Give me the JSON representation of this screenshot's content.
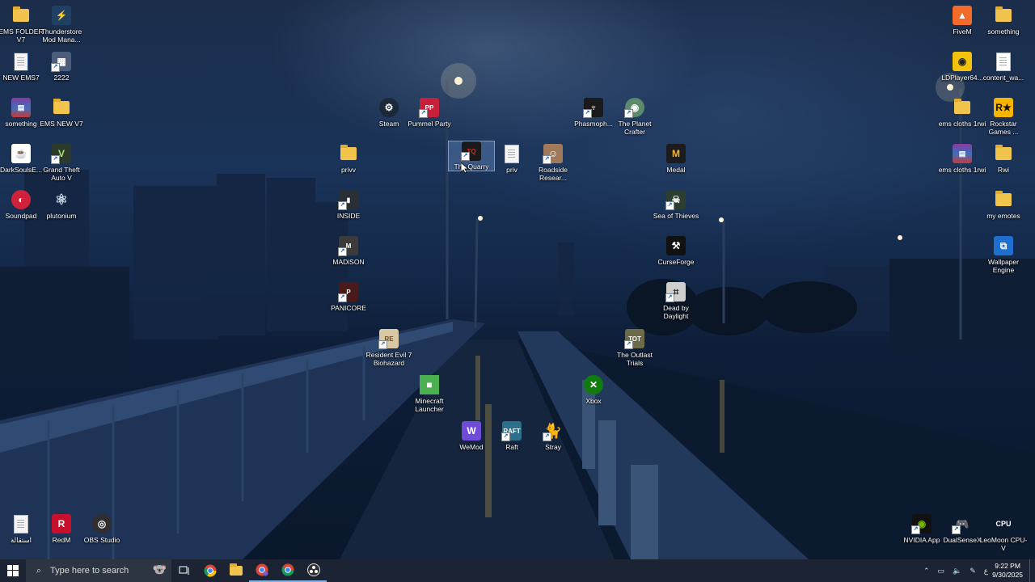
{
  "desktop": {
    "icons": [
      {
        "label": "EMS FOLDER V7"
      },
      {
        "label": "Thunderstore Mod Mana..."
      },
      {
        "label": "NEW EMS7"
      },
      {
        "label": "2222"
      },
      {
        "label": "something"
      },
      {
        "label": "EMS NEW V7"
      },
      {
        "label": "DarkSoulsE..."
      },
      {
        "label": "Grand Theft Auto V"
      },
      {
        "label": "Soundpad"
      },
      {
        "label": "plutonium"
      },
      {
        "label": "Steam"
      },
      {
        "label": "Pummel Party"
      },
      {
        "label": "The Quarry"
      },
      {
        "label": "privv"
      },
      {
        "label": "priv"
      },
      {
        "label": "Roadside Resear..."
      },
      {
        "label": "INSIDE"
      },
      {
        "label": "MADiSON"
      },
      {
        "label": "PANICORE"
      },
      {
        "label": "Resident Evil 7 Biohazard"
      },
      {
        "label": "Minecraft Launcher"
      },
      {
        "label": "WeMod"
      },
      {
        "label": "Raft"
      },
      {
        "label": "Stray"
      },
      {
        "label": "Phasmoph..."
      },
      {
        "label": "The Planet Crafter"
      },
      {
        "label": "Medal"
      },
      {
        "label": "Sea of Thieves"
      },
      {
        "label": "CurseForge"
      },
      {
        "label": "Dead by Daylight"
      },
      {
        "label": "The Outlast Trials"
      },
      {
        "label": "Xbox"
      },
      {
        "label": "FiveM"
      },
      {
        "label": "something"
      },
      {
        "label": "LDPlayer64..."
      },
      {
        "label": "content_wa..."
      },
      {
        "label": "ems cloths 1rwi"
      },
      {
        "label": "Rockstar Games ..."
      },
      {
        "label": "ems cloths 1rwi"
      },
      {
        "label": "Rwi"
      },
      {
        "label": "my emotes"
      },
      {
        "label": "Wallpaper Engine"
      },
      {
        "label": "استقالة"
      },
      {
        "label": "RedM"
      },
      {
        "label": "OBS Studio"
      },
      {
        "label": "NVIDIA App"
      },
      {
        "label": "DualSenseX"
      },
      {
        "label": "LeoMoon CPU-V"
      }
    ]
  },
  "taskbar": {
    "search_placeholder": "Type here to search",
    "tray_lang": "ع",
    "time": "9:22 PM",
    "date": "9/30/2025"
  },
  "colors": {
    "taskbar_bg": "#1c2433",
    "folder": "#f1c44d"
  }
}
